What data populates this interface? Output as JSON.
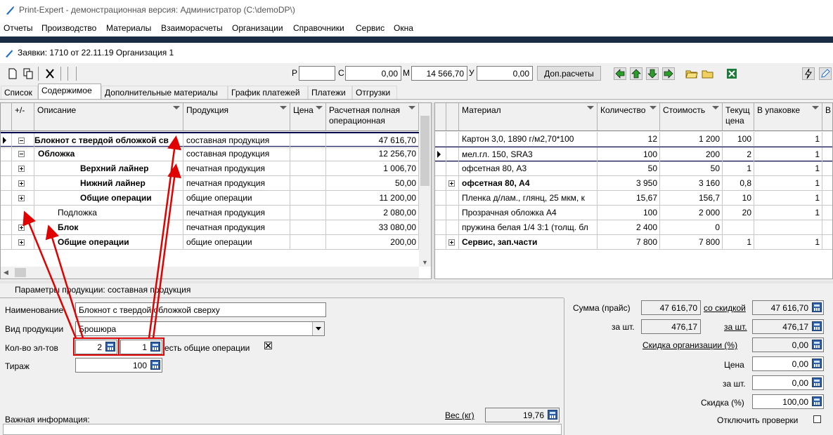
{
  "window": {
    "title": "Print-Expert - демонстрационная версия: Администратор (C:\\demoDP\\)"
  },
  "menu": [
    "Отчеты",
    "Производство",
    "Материалы",
    "Взаиморасчеты",
    "Организации",
    "Справочники",
    "Сервис",
    "Окна"
  ],
  "doc": {
    "title": "Заявки: 1710 от 22.11.19  Организация 1"
  },
  "toolbar": {
    "r_label": "Р",
    "r_value": "",
    "s_label": "С",
    "s_value": "0,00",
    "m_label": "М",
    "m_value": "14 566,70",
    "u_label": "У",
    "u_value": "0,00",
    "dop_button": "Доп.расчеты"
  },
  "tabs": [
    "Список",
    "Содержимое",
    "Дополнительные материалы",
    "График платежей",
    "Платежи",
    "Отгрузки"
  ],
  "left_grid": {
    "headers": [
      "+/-",
      "Описание",
      "Продукция",
      "Цена",
      "Расчетная полная операционная"
    ],
    "rows": [
      {
        "desc": "Блокнот с твердой обложкой св",
        "prod": "составная продукция",
        "price": "",
        "total": "47 616,70"
      },
      {
        "desc": "Обложка",
        "prod": "составная продукция",
        "price": "",
        "total": "12 256,70"
      },
      {
        "desc": "Верхний лайнер",
        "prod": "печатная продукция",
        "price": "",
        "total": "1 006,70"
      },
      {
        "desc": "Нижний лайнер",
        "prod": "печатная продукция",
        "price": "",
        "total": "50,00"
      },
      {
        "desc": "Общие операции",
        "prod": "общие операции",
        "price": "",
        "total": "11 200,00"
      },
      {
        "desc": "Подложка",
        "prod": "печатная продукция",
        "price": "",
        "total": "2 080,00"
      },
      {
        "desc": "Блок",
        "prod": "печатная продукция",
        "price": "",
        "total": "33 080,00"
      },
      {
        "desc": "Общие операции",
        "prod": "общие операции",
        "price": "",
        "total": "200,00"
      }
    ]
  },
  "right_grid": {
    "headers": [
      "Материал",
      "Количество",
      "Стоимость",
      "Текущ цена",
      "В упаковке",
      "В"
    ],
    "rows": [
      {
        "mat": "Картон 3,0, 1890 г/м2,70*100",
        "qty": "12",
        "cost": "1 200",
        "price": "100",
        "pack": "1"
      },
      {
        "mat": "мел.гл. 150, SRA3",
        "qty": "100",
        "cost": "200",
        "price": "2",
        "pack": "1"
      },
      {
        "mat": "офсетная 80, А3",
        "qty": "50",
        "cost": "50",
        "price": "1",
        "pack": "1"
      },
      {
        "mat": "офсетная 80, А4",
        "qty": "3 950",
        "cost": "3 160",
        "price": "0,8",
        "pack": "1"
      },
      {
        "mat": "Пленка д/лам., глянц, 25 мкм, к",
        "qty": "15,67",
        "cost": "156,7",
        "price": "10",
        "pack": "1"
      },
      {
        "mat": "Прозрачная обложка А4",
        "qty": "100",
        "cost": "2 000",
        "price": "20",
        "pack": "1"
      },
      {
        "mat": "пружина белая 1/4 3:1 (толщ. бл",
        "qty": "2 400",
        "cost": "0",
        "price": "",
        "pack": ""
      },
      {
        "mat": "Сервис, зап.части",
        "qty": "7 800",
        "cost": "7 800",
        "price": "1",
        "pack": "1"
      }
    ]
  },
  "params": {
    "header": "Параметры продукции: составная продукция",
    "name_label": "Наименование",
    "name_value": "Блокнот с твердой обложкой сверху",
    "kind_label": "Вид продукции",
    "kind_value": "Брошюра",
    "count_label": "Кол-во эл-тов",
    "count_value": "2",
    "count2_value": "1",
    "ops_label": "есть общие операции",
    "tirazh_label": "Тираж",
    "tirazh_value": "100",
    "info_label": "Важная информация:",
    "weight_label": "Вес (кг)",
    "weight_value": "19,76"
  },
  "summary": {
    "sum_label": "Сумма (прайс)",
    "sum_value": "47 616,70",
    "discount_link": "со скидкой",
    "discount_value": "47 616,70",
    "per_label": "за шт.",
    "per_value": "476,17",
    "per_link": "за шт.",
    "per_disc_value": "476,17",
    "org_disc_link": "Скидка организации (%)",
    "org_disc_value": "0,00",
    "price_label": "Цена",
    "price_value": "0,00",
    "per2_label": "за шт.",
    "per2_value": "0,00",
    "disc_label": "Скидка (%)",
    "disc_value": "100,00",
    "checks_label": "Отключить проверки"
  }
}
